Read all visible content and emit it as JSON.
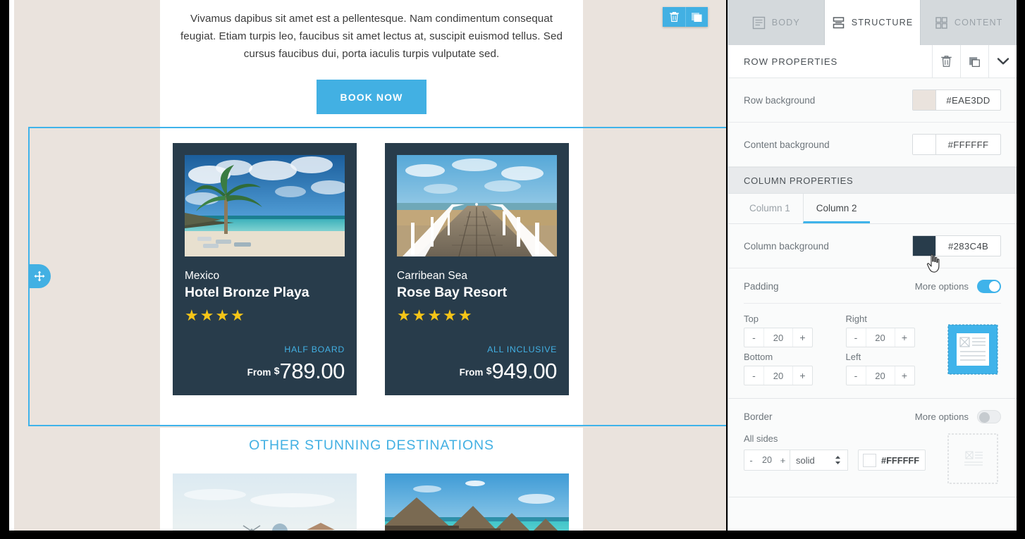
{
  "email": {
    "paragraph": "Vivamus dapibus sit amet est a pellentesque. Nam condimentum consequat feugiat. Etiam turpis leo, faucibus sit amet lectus at, suscipit euismod tellus. Sed cursus faucibus dui, porta iaculis turpis vulputate sed.",
    "cta_label": "BOOK NOW",
    "cards": [
      {
        "country": "Mexico",
        "title": "Hotel Bronze Playa",
        "stars": "★★★★",
        "board": "HALF BOARD",
        "from": "From",
        "currency": "$",
        "price": "789.00",
        "photo_alt": "beach-palm-tree-photo"
      },
      {
        "country": "Carribean Sea",
        "title": "Rose Bay Resort",
        "stars": "★★★★★",
        "board": "ALL INCLUSIVE",
        "from": "From",
        "currency": "$",
        "price": "949.00",
        "photo_alt": "wooden-pier-photo"
      }
    ],
    "other_heading": "OTHER STUNNING DESTINATIONS",
    "thumbs": [
      {
        "alt": "greek-village-windmill-photo"
      },
      {
        "alt": "overwater-bungalows-photo"
      }
    ],
    "row_toolbar": {
      "delete_icon": "trash-icon",
      "duplicate_icon": "copy-icon"
    },
    "drag_handle_icon": "move-arrows-icon",
    "accent_color": "#42b0e3",
    "row_background_color": "#eae3dd",
    "card_background_color": "#283c4b",
    "star_color": "#f5c518"
  },
  "panel": {
    "tabs": [
      {
        "label": "BODY",
        "icon": "body-lines-icon",
        "active": false
      },
      {
        "label": "STRUCTURE",
        "icon": "rows-icon",
        "active": true
      },
      {
        "label": "CONTENT",
        "icon": "grid-squares-icon",
        "active": false
      }
    ],
    "row_properties": {
      "title": "ROW PROPERTIES",
      "actions": [
        {
          "name": "delete-row",
          "icon": "trash-icon"
        },
        {
          "name": "duplicate-row",
          "icon": "copy-icon"
        },
        {
          "name": "collapse-section",
          "icon": "chevron-down-icon"
        }
      ],
      "fields": [
        {
          "label": "Row background",
          "value": "#EAE3DD",
          "swatch": "#EAE3DD"
        },
        {
          "label": "Content background",
          "value": "#FFFFFF",
          "swatch": "#FFFFFF"
        }
      ]
    },
    "column_properties": {
      "title": "COLUMN PROPERTIES",
      "tabs": [
        {
          "label": "Column 1",
          "active": false
        },
        {
          "label": "Column 2",
          "active": true
        }
      ],
      "background": {
        "label": "Column background",
        "value": "#283C4B",
        "swatch": "#283C4B"
      },
      "padding": {
        "label": "Padding",
        "more_options_label": "More options",
        "enabled": true,
        "top": {
          "label": "Top",
          "value": "20"
        },
        "right": {
          "label": "Right",
          "value": "20"
        },
        "bottom": {
          "label": "Bottom",
          "value": "20"
        },
        "left": {
          "label": "Left",
          "value": "20"
        },
        "minus": "-",
        "plus": "+",
        "preview_icon": "padding-preview-icon"
      },
      "border": {
        "label": "Border",
        "more_options_label": "More options",
        "enabled": false,
        "all_sides_label": "All sides",
        "width": "20",
        "style": "solid",
        "color": "#FFFFFF",
        "minus": "-",
        "plus": "+",
        "preview_icon": "border-preview-icon"
      }
    }
  },
  "cursor": {
    "icon": "pointing-hand-cursor"
  }
}
